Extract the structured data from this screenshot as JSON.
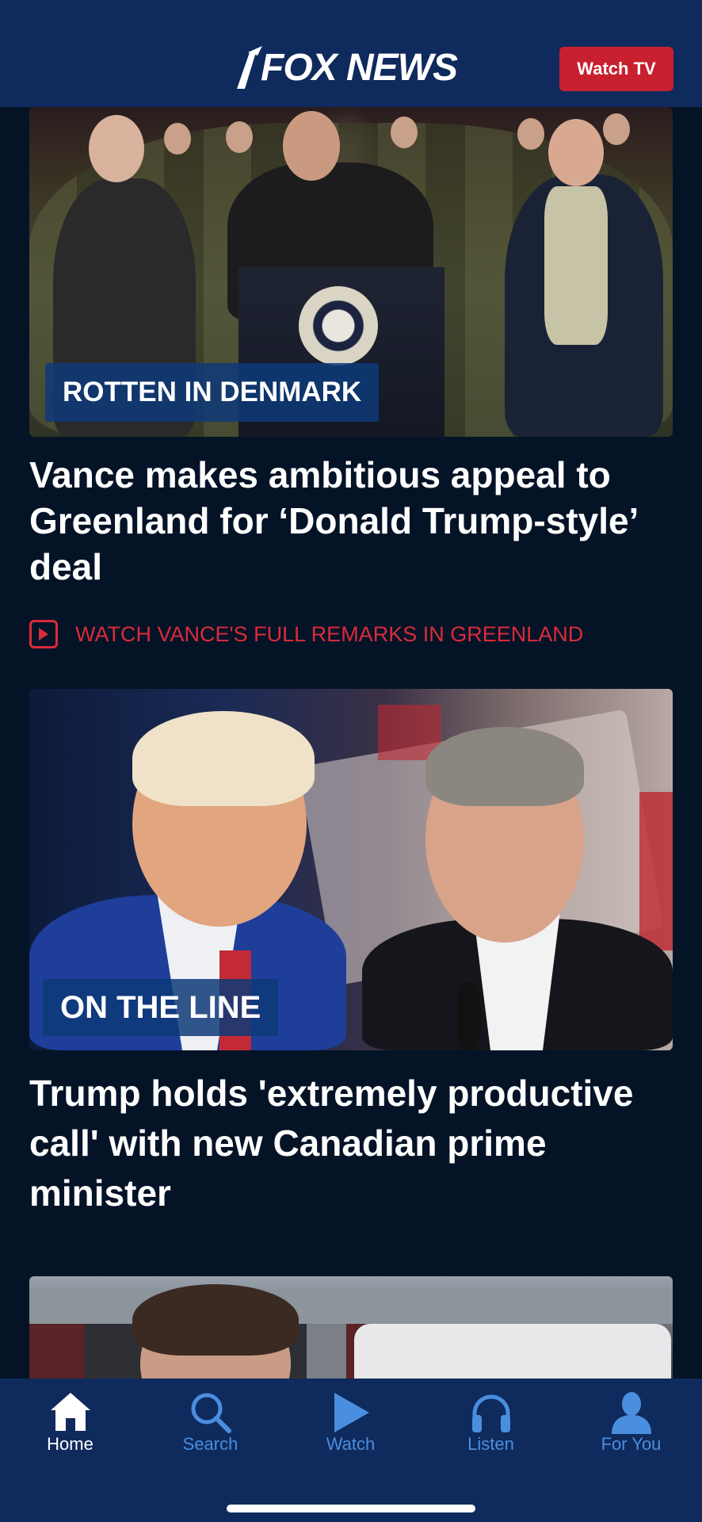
{
  "header": {
    "logo_text": "FOX NEWS",
    "watch_tv_label": "Watch TV"
  },
  "stories": [
    {
      "kicker": "ROTTEN IN DENMARK",
      "headline": "Vance makes ambitious appeal to Greenland for ‘Donald Trump-style’ deal",
      "watch_link": "WATCH VANCE'S FULL REMARKS IN GREENLAND"
    },
    {
      "kicker": "ON THE LINE",
      "headline": "Trump holds 'extremely productive call' with new Canadian prime minister"
    }
  ],
  "tabbar": {
    "items": [
      {
        "label": "Home",
        "icon": "home-icon",
        "active": true
      },
      {
        "label": "Search",
        "icon": "search-icon",
        "active": false
      },
      {
        "label": "Watch",
        "icon": "play-icon",
        "active": false
      },
      {
        "label": "Listen",
        "icon": "headphones-icon",
        "active": false
      },
      {
        "label": "For You",
        "icon": "person-icon",
        "active": false
      }
    ]
  },
  "colors": {
    "header_bg": "#0f2a5c",
    "page_bg": "#051327",
    "watch_tv_bg": "#c8202f",
    "link_red": "#d92b3a",
    "tab_inactive": "#4a8ee0"
  }
}
